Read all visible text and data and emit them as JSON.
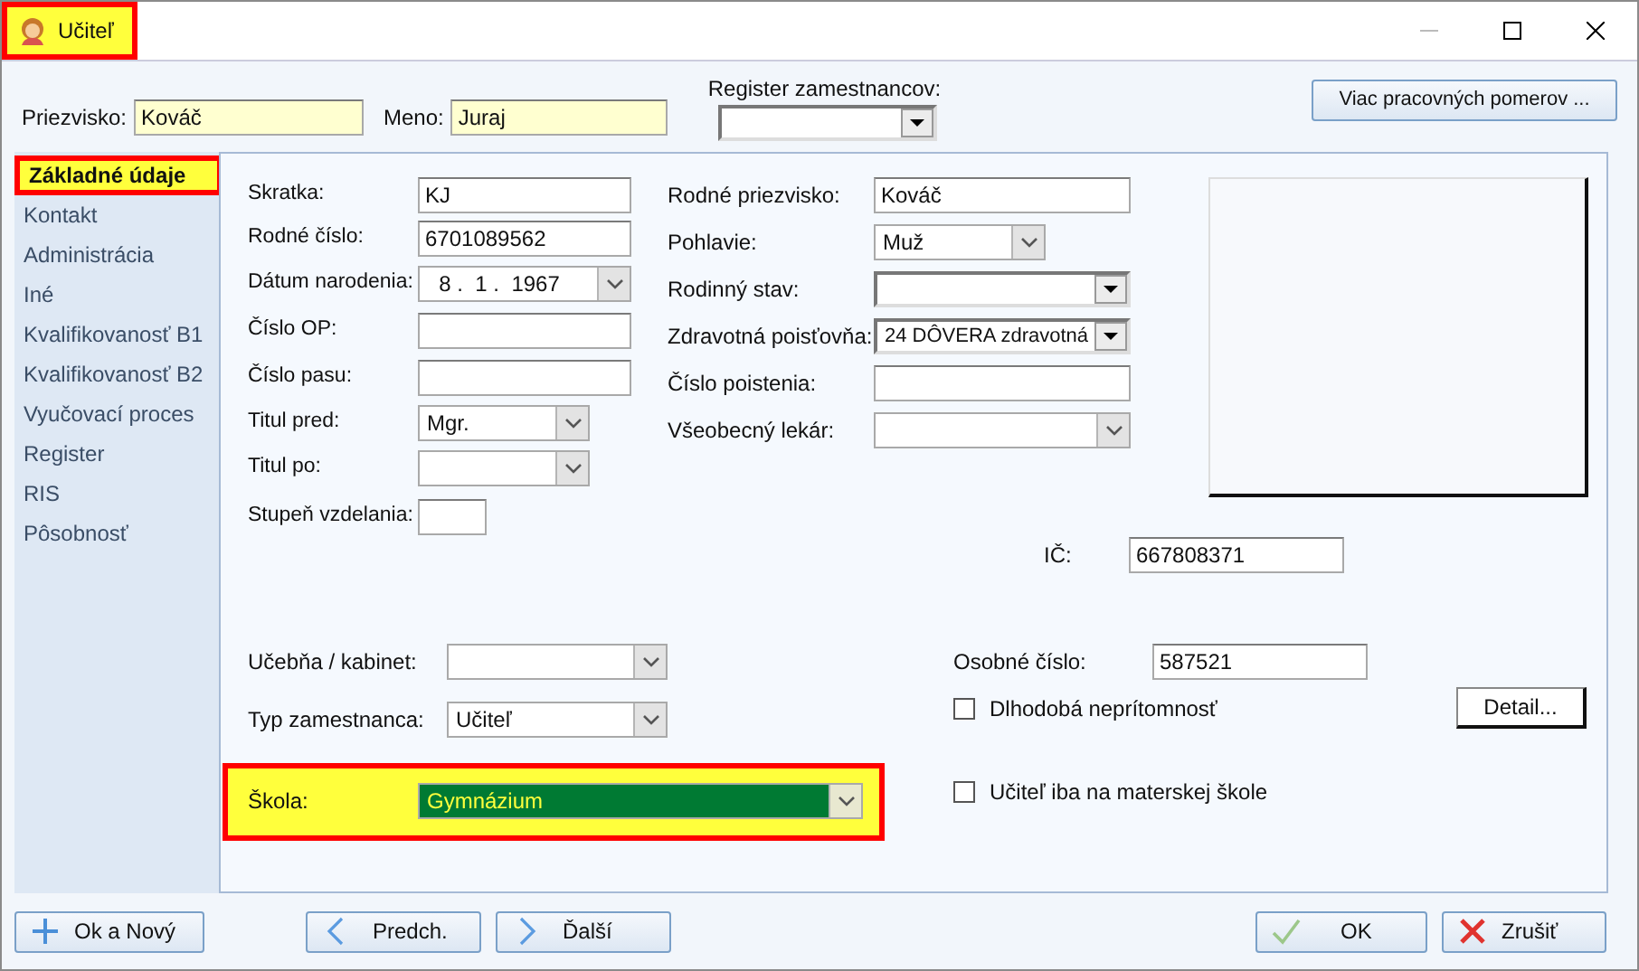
{
  "window": {
    "title": "Učiteľ",
    "highlighted": true
  },
  "header": {
    "fields": [
      {
        "label": "Priezvisko:",
        "value": "Kováč"
      },
      {
        "label": "Meno:",
        "value": "Juraj"
      }
    ],
    "register": {
      "label": "Register zamestnancov:"
    },
    "button": "Viac pracovných pomerov ..."
  },
  "sidebar": {
    "items": [
      {
        "label": "Základné údaje",
        "selected": true,
        "highlighted": true
      },
      {
        "label": "Kontakt",
        "selected": false,
        "highlighted": false
      },
      {
        "label": "Administrácia",
        "selected": false,
        "highlighted": false
      },
      {
        "label": "Iné",
        "selected": false,
        "highlighted": false
      },
      {
        "label": "Kvalifikovanosť B1",
        "selected": false,
        "highlighted": false
      },
      {
        "label": "Kvalifikovanosť B2",
        "selected": false,
        "highlighted": false
      },
      {
        "label": "Vyučovací proces",
        "selected": false,
        "highlighted": false
      },
      {
        "label": "Register",
        "selected": false,
        "highlighted": false
      },
      {
        "label": "RIS",
        "selected": false,
        "highlighted": false
      },
      {
        "label": "Pôsobnosť",
        "selected": false,
        "highlighted": false
      }
    ]
  },
  "form": {
    "left": [
      {
        "label": "Skratka:",
        "kind": "text",
        "value": "KJ"
      },
      {
        "label": "Rodné číslo:",
        "kind": "text",
        "value": "6701089562"
      },
      {
        "label": "Dátum narodenia:",
        "kind": "date",
        "value": "8 .  1 .  1967"
      },
      {
        "label": "Číslo OP:",
        "kind": "text"
      },
      {
        "label": "Číslo pasu:",
        "kind": "text"
      },
      {
        "label": "Titul pred:",
        "kind": "combo",
        "value": "Mgr."
      },
      {
        "label": "Titul po:",
        "kind": "combo"
      },
      {
        "label": "Stupeň vzdelania:",
        "kind": "text"
      }
    ],
    "middle": [
      {
        "label": "Rodné priezvisko:",
        "kind": "text",
        "value": "Kováč"
      },
      {
        "label": "Pohlavie:",
        "kind": "combo",
        "value": "Muž"
      },
      {
        "label": "Rodinný stav:",
        "kind": "dropdown"
      },
      {
        "label": "Zdravotná poisťovňa:",
        "kind": "dropdown",
        "value": "24 DÔVERA zdravotná"
      },
      {
        "label": "Číslo poistenia:",
        "kind": "text"
      },
      {
        "label": "Všeobecný lekár:",
        "kind": "combo"
      }
    ],
    "ic": {
      "label": "IČ:",
      "value": "667808371"
    },
    "bottom_left": [
      {
        "label": "Učebňa / kabinet:",
        "kind": "combo",
        "selected": false,
        "highlighted": false
      },
      {
        "label": "Typ zamestnanca:",
        "kind": "combo",
        "value": "Učiteľ",
        "selected": false,
        "highlighted": false
      },
      {
        "label": "Škola:",
        "kind": "combo",
        "value": "Gymnázium",
        "selected": true,
        "highlighted": true
      }
    ],
    "bottom_right": [
      {
        "kind": "text",
        "label": "Osobné číslo:",
        "value": "587521"
      },
      {
        "kind": "checkbox",
        "label": "Dlhodobá neprítomnosť",
        "checked": false,
        "button": "Detail..."
      },
      {
        "kind": "checkbox",
        "label": "Učiteľ iba na materskej škole",
        "checked": false
      }
    ]
  },
  "buttons": [
    {
      "kind": "add",
      "label": "Ok a Nový"
    },
    {
      "kind": "prev",
      "label": "Predch."
    },
    {
      "kind": "next",
      "label": "Ďalší"
    },
    {
      "kind": "ok",
      "label": "OK"
    },
    {
      "kind": "cancel",
      "label": "Zrušiť"
    }
  ]
}
